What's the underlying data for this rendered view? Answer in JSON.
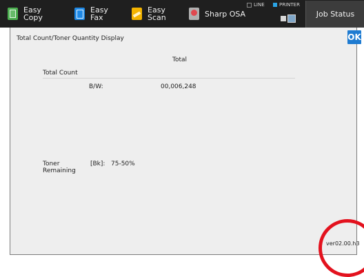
{
  "topbar": {
    "apps": [
      {
        "line1": "Easy",
        "line2": "Copy",
        "icon": "copy-icon",
        "color": "#4caf50"
      },
      {
        "line1": "Easy",
        "line2": "Fax",
        "icon": "fax-icon",
        "color": "#1e88e5"
      },
      {
        "line1": "Easy",
        "line2": "Scan",
        "icon": "scan-icon",
        "color": "#f4b400"
      },
      {
        "label": "Sharp OSA",
        "icon": "osa-icon"
      }
    ],
    "status_line": "LINE",
    "status_printer": "PRINTER",
    "job_status": "Job Status"
  },
  "screen": {
    "title": "Total Count/Toner Quantity Display",
    "ok_label": "OK",
    "column_header": "Total",
    "total_count_label": "Total Count",
    "bw_label": "B/W:",
    "bw_value": "00,006,248",
    "toner_label_line1": "Toner",
    "toner_label_line2": "Remaining",
    "toner_color_label": "[Bk]:",
    "toner_value": "75-50%",
    "version": "ver02.00.h3"
  },
  "colors": {
    "accent_ok": "#1e7bd1",
    "highlight_circle": "#e3121e",
    "printer_indicator": "#2aa4e6"
  }
}
